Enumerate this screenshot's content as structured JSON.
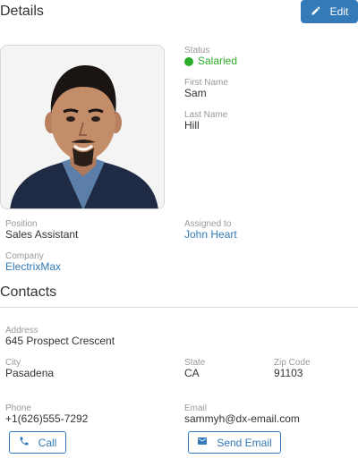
{
  "details": {
    "title": "Details",
    "edit_label": "Edit"
  },
  "profile": {
    "status_label": "Status",
    "status_value": "Salaried",
    "status_color": "#2cab29",
    "first_name_label": "First Name",
    "first_name": "Sam",
    "last_name_label": "Last Name",
    "last_name": "Hill",
    "position_label": "Position",
    "position": "Sales Assistant",
    "assigned_label": "Assigned to",
    "assigned_to": "John Heart",
    "company_label": "Company",
    "company": "ElectrixMax"
  },
  "contacts": {
    "title": "Contacts",
    "address_label": "Address",
    "address": "645 Prospect Crescent",
    "city_label": "City",
    "city": "Pasadena",
    "state_label": "State",
    "state": "CA",
    "zip_label": "Zip Code",
    "zip": "91103",
    "phone_label": "Phone",
    "phone": "+1(626)555-7292",
    "email_label": "Email",
    "email": "sammyh@dx-email.com",
    "call_label": "Call",
    "send_email_label": "Send Email"
  },
  "colors": {
    "accent": "#337ab7",
    "label": "#999999",
    "text": "#333333"
  }
}
